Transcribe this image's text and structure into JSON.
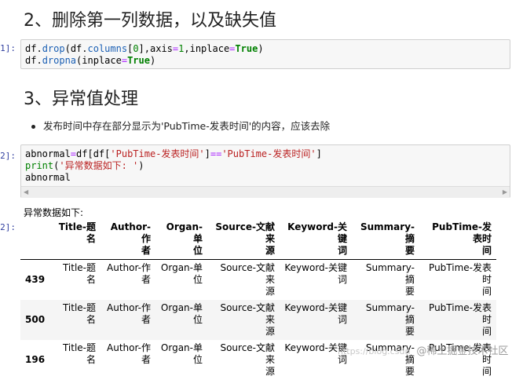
{
  "section2": {
    "heading": "2、删除第一列数据，以及缺失值",
    "prompt": "1]:",
    "code_line1_pre": "df.",
    "code_line1_fn": "drop",
    "code_line1_mid": "(df.",
    "code_line1_attr": "columns",
    "code_line1_idx_open": "[",
    "code_line1_idx": "0",
    "code_line1_idx_close": "],axis",
    "code_line1_eq": "=",
    "code_line1_one": "1",
    "code_line1_comma": ",inplace",
    "code_line1_eq2": "=",
    "code_line1_true": "True",
    "code_line1_close": ")",
    "code_line2_pre": "df.",
    "code_line2_fn": "dropna",
    "code_line2_mid": "(inplace",
    "code_line2_eq": "=",
    "code_line2_true": "True",
    "code_line2_close": ")"
  },
  "section3": {
    "heading": "3、异常值处理",
    "bullet": "发布时间中存在部分显示为'PubTime-发表时间'的内容，应该去除",
    "prompt": "2]:",
    "code_line1_a": "abnormal",
    "code_line1_b": "=",
    "code_line1_c": "df[df[",
    "code_line1_s1": "'PubTime-发表时间'",
    "code_line1_d": "]",
    "code_line1_op": "==",
    "code_line1_s2": "'PubTime-发表时间'",
    "code_line1_e": "]",
    "code_line2_fn": "print",
    "code_line2_open": "(",
    "code_line2_s": "'异常数据如下: '",
    "code_line2_close": ")",
    "code_line3": "abnormal",
    "scroll_left": "◀",
    "scroll_right": "▶"
  },
  "output": {
    "prompt": "2]:",
    "label": "异常数据如下:",
    "columns": [
      [
        "Title-题",
        "名"
      ],
      [
        "Author-作",
        "者"
      ],
      [
        "Organ-单",
        "位"
      ],
      [
        "Source-文献来",
        "源"
      ],
      [
        "Keyword-关键",
        "词"
      ],
      [
        "Summary-摘",
        "要"
      ],
      [
        "PubTime-发表时",
        "间"
      ]
    ],
    "rows": [
      {
        "index": "439",
        "cells": [
          [
            "Title-题",
            "名"
          ],
          [
            "Author-作",
            "者"
          ],
          [
            "Organ-单",
            "位"
          ],
          [
            "Source-文献来",
            "源"
          ],
          [
            "Keyword-关键",
            "词"
          ],
          [
            "Summary-摘",
            "要"
          ],
          [
            "PubTime-发表时",
            "间"
          ]
        ]
      },
      {
        "index": "500",
        "cells": [
          [
            "Title-题",
            "名"
          ],
          [
            "Author-作",
            "者"
          ],
          [
            "Organ-单",
            "位"
          ],
          [
            "Source-文献来",
            "源"
          ],
          [
            "Keyword-关键",
            "词"
          ],
          [
            "Summary-摘",
            "要"
          ],
          [
            "PubTime-发表时",
            "间"
          ]
        ]
      },
      {
        "index": "196",
        "cells": [
          [
            "Title-题",
            "名"
          ],
          [
            "Author-作",
            "者"
          ],
          [
            "Organ-单",
            "位"
          ],
          [
            "Source-文献来",
            "源"
          ],
          [
            "Keyword-关键",
            "词"
          ],
          [
            "Summary-摘",
            "要"
          ],
          [
            "PubTime-发表时",
            "间"
          ]
        ]
      }
    ]
  },
  "watermark": {
    "url": "https://blog.csdn",
    "text": "@稀土掘金技术社区"
  }
}
